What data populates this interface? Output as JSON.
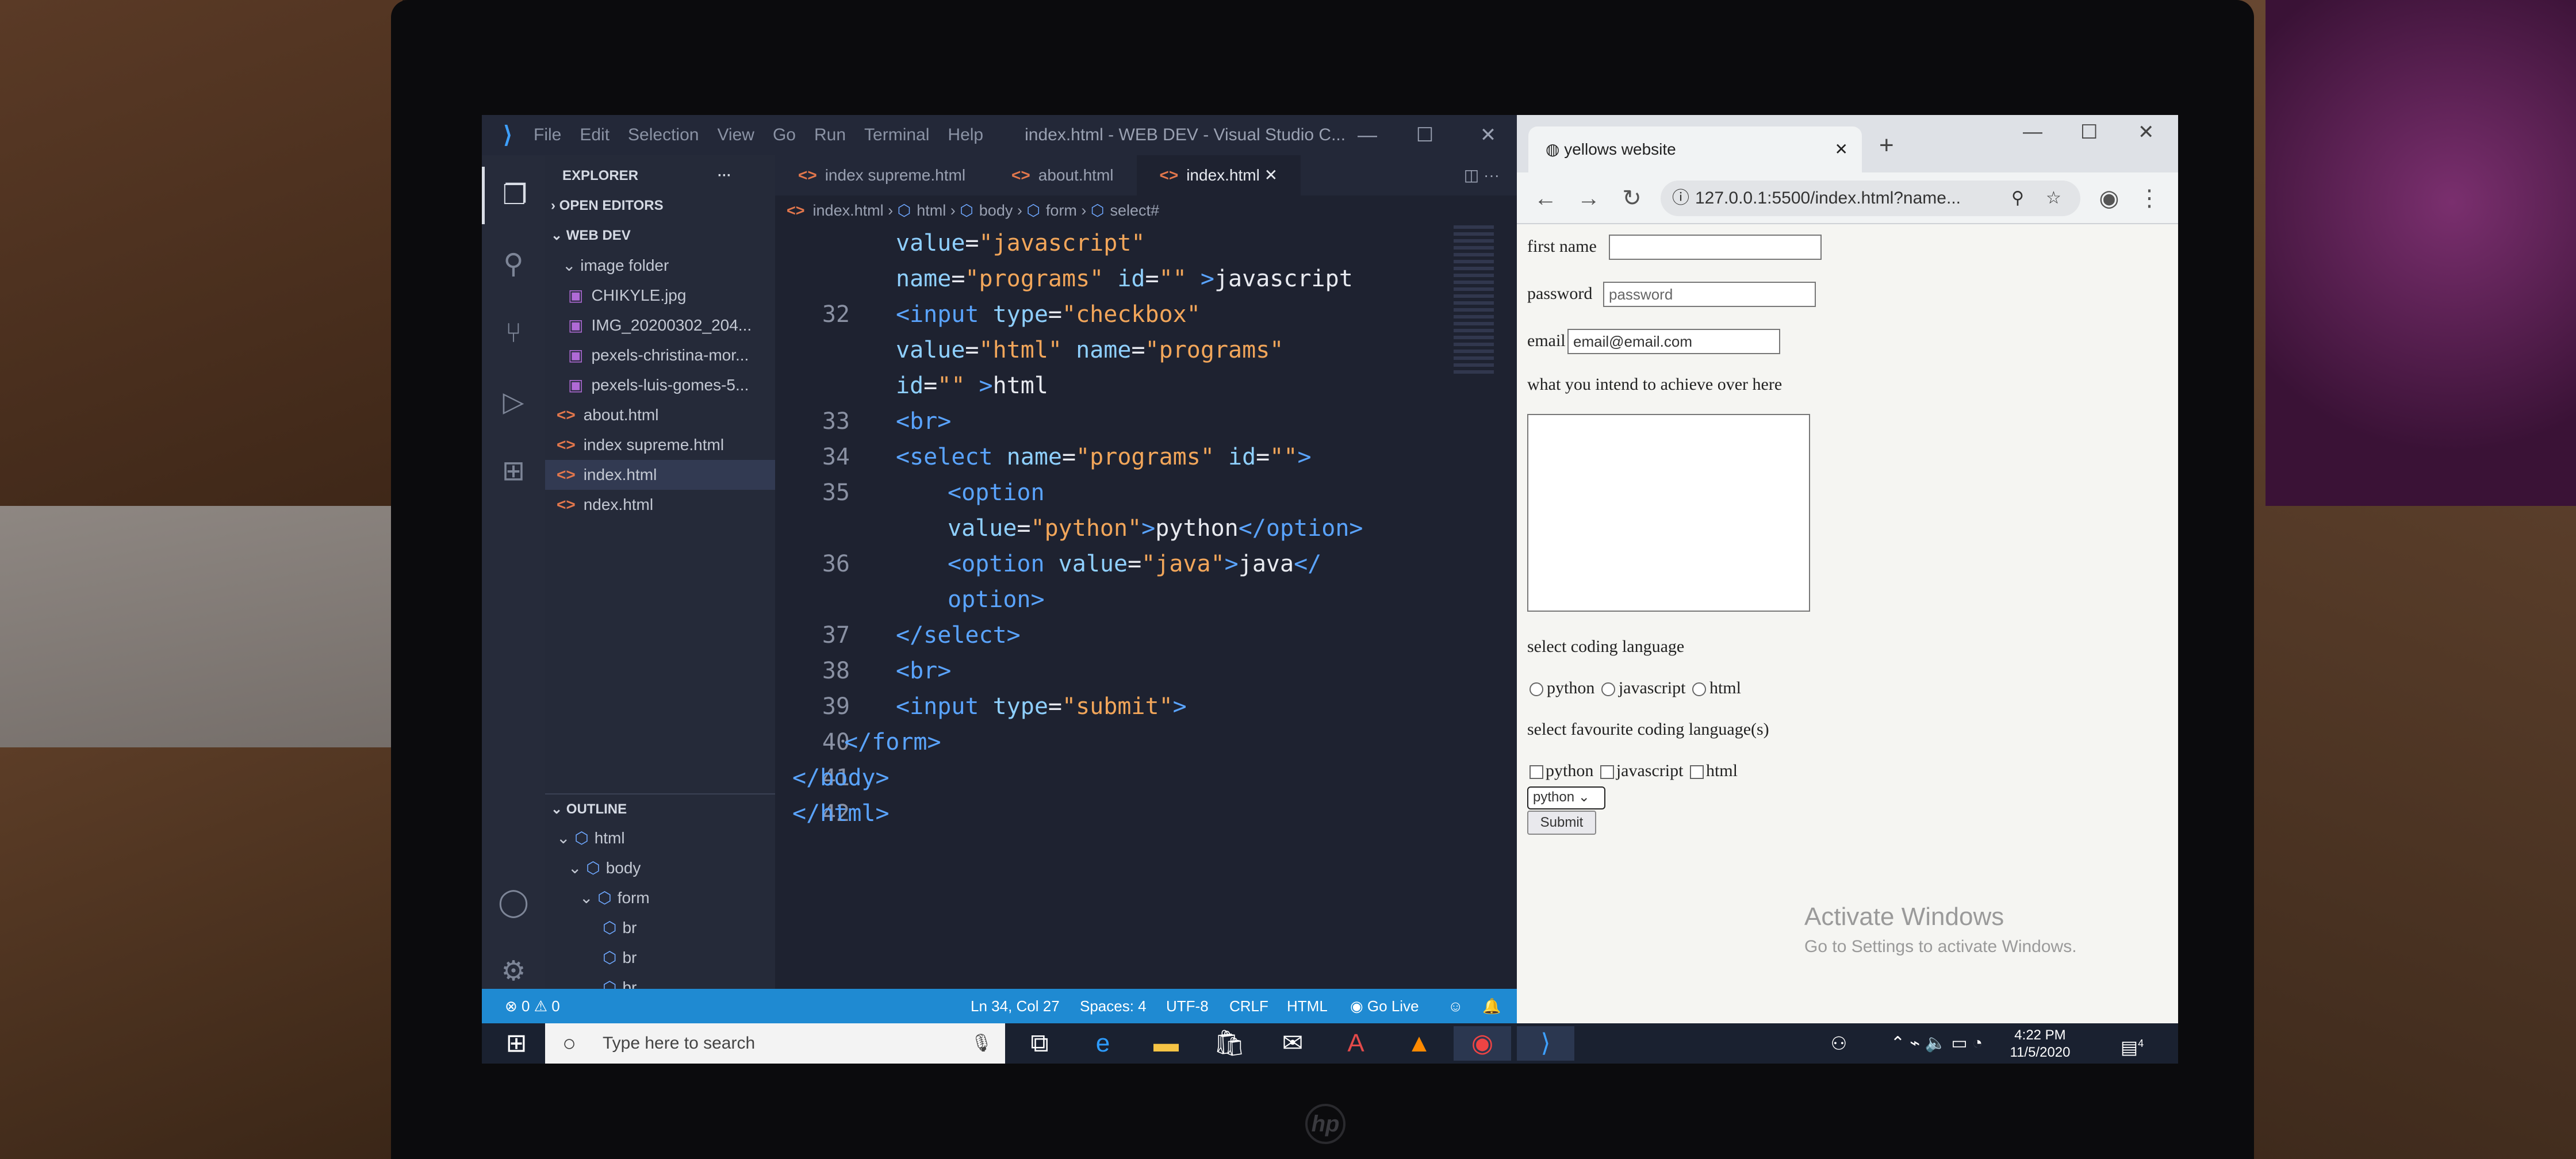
{
  "vscode": {
    "menu": [
      "File",
      "Edit",
      "Selection",
      "View",
      "Go",
      "Run",
      "Terminal",
      "Help"
    ],
    "window_title": "index.html - WEB DEV - Visual Studio C...",
    "explorer_label": "EXPLORER",
    "open_editors": "OPEN EDITORS",
    "workspace": "WEB DEV",
    "folder": "image folder",
    "folder_files": [
      "CHIKYLE.jpg",
      "IMG_20200302_204...",
      "pexels-christina-mor...",
      "pexels-luis-gomes-5..."
    ],
    "files": [
      "about.html",
      "index supreme.html",
      "index.html",
      "ndex.html"
    ],
    "outline_label": "OUTLINE",
    "outline": [
      "html",
      "body",
      "form",
      "br",
      "br",
      "br"
    ],
    "tabs": [
      "index supreme.html",
      "about.html",
      "index.html"
    ],
    "breadcrumb": [
      "index.html",
      "html",
      "body",
      "form",
      "select#"
    ],
    "code_lines": [
      {
        "n": "",
        "parts": [
          [
            "at",
            "value"
          ],
          [
            "tx",
            "="
          ],
          [
            "st",
            "\"javascript\""
          ]
        ]
      },
      {
        "n": "",
        "parts": [
          [
            "at",
            "name"
          ],
          [
            "tx",
            "="
          ],
          [
            "st",
            "\"programs\""
          ],
          [
            "tx",
            " "
          ],
          [
            "at",
            "id"
          ],
          [
            "tx",
            "="
          ],
          [
            "st",
            "\"\""
          ],
          [
            "tx",
            " "
          ],
          [
            "tg",
            ">"
          ],
          [
            "tx",
            "javascript"
          ]
        ]
      },
      {
        "n": "32",
        "parts": [
          [
            "tg",
            "<input "
          ],
          [
            "at",
            "type"
          ],
          [
            "tx",
            "="
          ],
          [
            "st",
            "\"checkbox\""
          ]
        ]
      },
      {
        "n": "",
        "parts": [
          [
            "at",
            "value"
          ],
          [
            "tx",
            "="
          ],
          [
            "st",
            "\"html\""
          ],
          [
            "tx",
            " "
          ],
          [
            "at",
            "name"
          ],
          [
            "tx",
            "="
          ],
          [
            "st",
            "\"programs\""
          ]
        ]
      },
      {
        "n": "",
        "parts": [
          [
            "at",
            "id"
          ],
          [
            "tx",
            "="
          ],
          [
            "st",
            "\"\""
          ],
          [
            "tx",
            " "
          ],
          [
            "tg",
            ">"
          ],
          [
            "tx",
            "html"
          ]
        ]
      },
      {
        "n": "33",
        "parts": [
          [
            "tg",
            "<br>"
          ]
        ]
      },
      {
        "n": "34",
        "parts": [
          [
            "tg",
            "<select "
          ],
          [
            "at",
            "name"
          ],
          [
            "tx",
            "="
          ],
          [
            "st",
            "\"programs\""
          ],
          [
            "tx",
            " "
          ],
          [
            "at",
            "id"
          ],
          [
            "tx",
            "="
          ],
          [
            "st",
            "\"\""
          ],
          [
            "tg",
            ">"
          ]
        ]
      },
      {
        "n": "35",
        "indent": 1,
        "parts": [
          [
            "tg",
            "<option"
          ]
        ]
      },
      {
        "n": "",
        "indent": 1,
        "parts": [
          [
            "at",
            "value"
          ],
          [
            "tx",
            "="
          ],
          [
            "st",
            "\"python\""
          ],
          [
            "tg",
            ">"
          ],
          [
            "tx",
            "python"
          ],
          [
            "tg",
            "</option>"
          ]
        ]
      },
      {
        "n": "36",
        "indent": 1,
        "parts": [
          [
            "tg",
            "<option "
          ],
          [
            "at",
            "value"
          ],
          [
            "tx",
            "="
          ],
          [
            "st",
            "\"java\""
          ],
          [
            "tg",
            ">"
          ],
          [
            "tx",
            "java"
          ],
          [
            "tg",
            "</"
          ]
        ]
      },
      {
        "n": "",
        "indent": 1,
        "parts": [
          [
            "tg",
            "option>"
          ]
        ]
      },
      {
        "n": "37",
        "parts": [
          [
            "tg",
            "</select>"
          ]
        ]
      },
      {
        "n": "38",
        "parts": [
          [
            "tg",
            "<br>"
          ]
        ]
      },
      {
        "n": "39",
        "parts": [
          [
            "tg",
            "<input "
          ],
          [
            "at",
            "type"
          ],
          [
            "tx",
            "="
          ],
          [
            "st",
            "\"submit\""
          ],
          [
            "tg",
            ">"
          ]
        ]
      },
      {
        "n": "40",
        "indent": -1,
        "parts": [
          [
            "tg",
            "</form>"
          ]
        ]
      },
      {
        "n": "41",
        "indent": -2,
        "parts": [
          [
            "tg",
            "</body>"
          ]
        ]
      },
      {
        "n": "42",
        "indent": -2,
        "parts": [
          [
            "tg",
            "</html>"
          ]
        ]
      }
    ],
    "status": {
      "problems": "⊗ 0 ⚠ 0",
      "position": "Ln 34, Col 27",
      "spaces": "Spaces: 4",
      "encoding": "UTF-8",
      "eol": "CRLF",
      "language": "HTML",
      "golive": "Go Live"
    }
  },
  "browser": {
    "tab_title": "yellows website",
    "url": "127.0.0.1:5500/index.html?name...",
    "form": {
      "first_name": "first name",
      "password_label": "password",
      "password_placeholder": "password",
      "email_label": "email",
      "email_value": "email@email.com",
      "textarea_label": "what you intend to achieve over here",
      "select_label": "select coding language",
      "radios": [
        "python",
        "javascript",
        "html"
      ],
      "fav_label": "select favourite coding language(s)",
      "checkboxes": [
        "python",
        "javascript",
        "html"
      ],
      "dropdown": "python",
      "submit": "Submit"
    },
    "watermark_title": "Activate Windows",
    "watermark_sub": "Go to Settings to activate Windows."
  },
  "taskbar": {
    "search_placeholder": "Type here to search",
    "time": "4:22 PM",
    "date": "11/5/2020",
    "notif_count": "4"
  }
}
